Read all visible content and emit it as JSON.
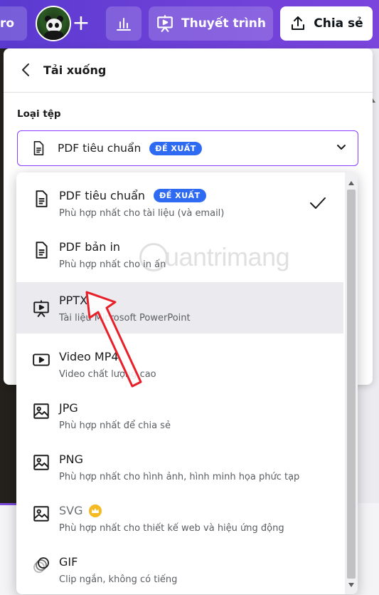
{
  "topbar": {
    "pro_label": "ro",
    "present_label": "Thuyết trình",
    "share_label": "Chia sẻ"
  },
  "panel": {
    "title": "Tải xuống",
    "file_type_label": "Loại tệp",
    "selected": {
      "name": "PDF tiêu chuẩn",
      "badge": "ĐỀ XUẤT"
    }
  },
  "options": [
    {
      "name": "PDF tiêu chuẩn",
      "badge": "ĐỀ XUẤT",
      "desc": "Phù hợp nhất cho tài liệu (và email)",
      "icon": "document-icon",
      "checked": true
    },
    {
      "name": "PDF bản in",
      "desc": "Phù hợp nhất cho in ấn",
      "icon": "document-icon"
    },
    {
      "name": "PPTX",
      "desc": "Tài liệu Microsoft PowerPoint",
      "icon": "presentation-icon",
      "hover": true
    },
    {
      "name": "Video MP4",
      "desc": "Video chất lượng cao",
      "icon": "video-icon"
    },
    {
      "name": "JPG",
      "desc": "Phù hợp nhất để chia sẻ",
      "icon": "image-icon"
    },
    {
      "name": "PNG",
      "desc": "Phù hợp nhất cho hình ảnh, hình minh họa phức tạp",
      "icon": "image-icon"
    },
    {
      "name": "SVG",
      "desc": "Phù hợp nhất cho thiết kế web và hiệu ứng động",
      "icon": "image-icon",
      "premium": true
    },
    {
      "name": "GIF",
      "desc": "Clip ngắn, không có tiếng",
      "icon": "gif-icon"
    }
  ],
  "watermark": {
    "text": "uantrimang"
  },
  "colors": {
    "accent": "#8b3dff",
    "badge": "#2f6bf2",
    "crown": "#f5b921",
    "arrow": "#e8202a"
  }
}
